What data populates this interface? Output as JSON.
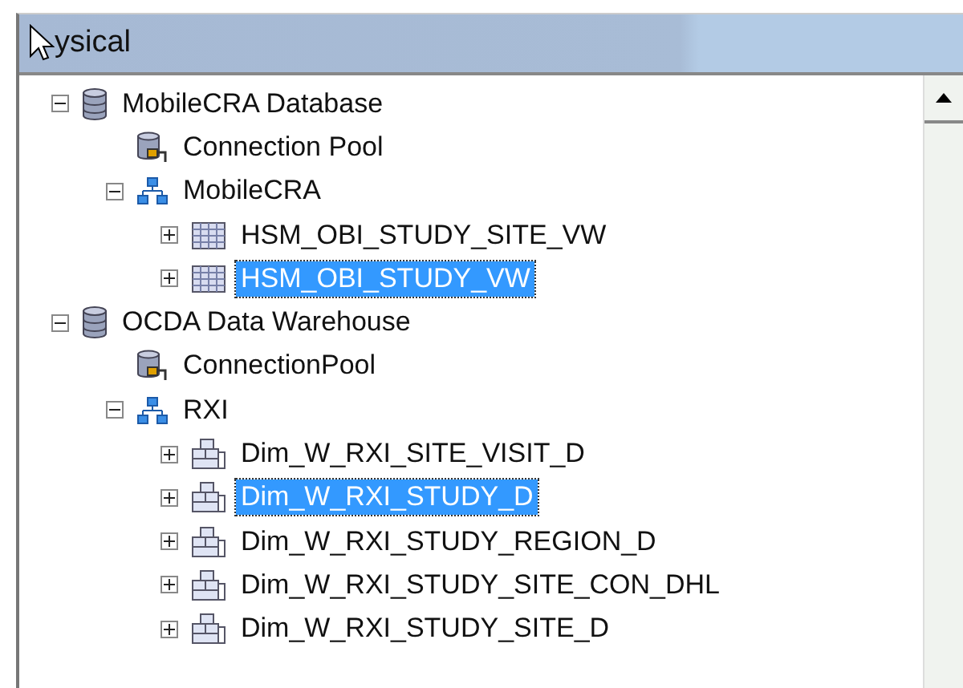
{
  "panel": {
    "title": "ysical"
  },
  "tree": [
    {
      "label": "MobileCRA Database",
      "kind": "database",
      "expanded": true,
      "selected": false,
      "children": [
        {
          "label": "Connection Pool",
          "kind": "pool",
          "selected": false
        },
        {
          "label": "MobileCRA",
          "kind": "schema",
          "expanded": true,
          "selected": false,
          "children": [
            {
              "label": "HSM_OBI_STUDY_SITE_VW",
              "kind": "table",
              "expanded": false,
              "selected": false
            },
            {
              "label": "HSM_OBI_STUDY_VW",
              "kind": "table",
              "expanded": false,
              "selected": true
            }
          ]
        }
      ]
    },
    {
      "label": "OCDA Data Warehouse",
      "kind": "database",
      "expanded": true,
      "selected": false,
      "children": [
        {
          "label": "ConnectionPool",
          "kind": "pool",
          "selected": false
        },
        {
          "label": "RXI",
          "kind": "schema",
          "expanded": true,
          "selected": false,
          "children": [
            {
              "label": "Dim_W_RXI_SITE_VISIT_D",
              "kind": "dimension",
              "expanded": false,
              "selected": false
            },
            {
              "label": "Dim_W_RXI_STUDY_D",
              "kind": "dimension",
              "expanded": false,
              "selected": true
            },
            {
              "label": "Dim_W_RXI_STUDY_REGION_D",
              "kind": "dimension",
              "expanded": false,
              "selected": false
            },
            {
              "label": "Dim_W_RXI_STUDY_SITE_CON_DHL",
              "kind": "dimension",
              "expanded": false,
              "selected": false
            },
            {
              "label": "Dim_W_RXI_STUDY_SITE_D",
              "kind": "dimension",
              "expanded": false,
              "selected": false
            }
          ]
        }
      ]
    }
  ]
}
